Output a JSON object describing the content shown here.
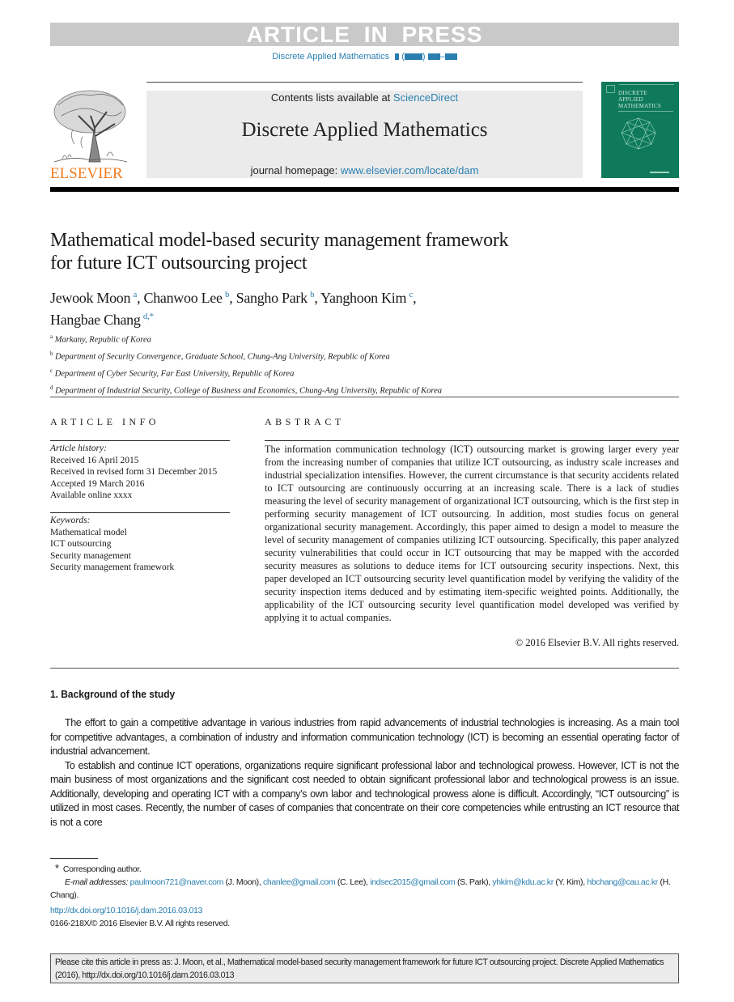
{
  "banner": {
    "text": "ARTICLE IN PRESS"
  },
  "running_head": {
    "journal": "Discrete Applied Mathematics"
  },
  "masthead": {
    "publisher": "ELSEVIER",
    "contents_prefix": "Contents lists available at ",
    "contents_link": "ScienceDirect",
    "journal_name": "Discrete Applied Mathematics",
    "homepage_prefix": "journal homepage: ",
    "homepage_link": "www.elsevier.com/locate/dam",
    "cover": {
      "line1": "DISCRETE",
      "line2": "APPLIED",
      "line3": "MATHEMATICS",
      "color": "#0e7a5b"
    }
  },
  "article": {
    "title_line1": "Mathematical model-based security management framework",
    "title_line2": "for future ICT outsourcing project",
    "authors": [
      {
        "name": "Jewook Moon",
        "aff": "a"
      },
      {
        "name": "Chanwoo Lee",
        "aff": "b"
      },
      {
        "name": "Sangho Park",
        "aff": "b"
      },
      {
        "name": "Yanghoon Kim",
        "aff": "c"
      },
      {
        "name": "Hangbae Chang",
        "aff": "d,*"
      }
    ],
    "affiliations": [
      {
        "label": "a",
        "text": "Markany, Republic of Korea"
      },
      {
        "label": "b",
        "text": "Department of Security Convergence, Graduate School, Chung-Ang University, Republic of Korea"
      },
      {
        "label": "c",
        "text": "Department of Cyber Security, Far East University, Republic of Korea"
      },
      {
        "label": "d",
        "text": "Department of Industrial Security, College of Business and Economics, Chung-Ang University, Republic of Korea"
      }
    ]
  },
  "article_info": {
    "heading": "ARTICLE INFO",
    "history_label": "Article history:",
    "history": [
      "Received 16 April 2015",
      "Received in revised form 31 December 2015",
      "Accepted 19 March 2016",
      "Available online xxxx"
    ],
    "keywords_label": "Keywords:",
    "keywords": [
      "Mathematical model",
      "ICT outsourcing",
      "Security management",
      "Security management framework"
    ]
  },
  "abstract": {
    "heading": "ABSTRACT",
    "text": "The information communication technology (ICT) outsourcing market is growing larger every year from the increasing number of companies that utilize ICT outsourcing, as in­dustry scale increases and industrial specialization intensifies. However, the current cir­cumstance is that security accidents related to ICT outsourcing are continuously occurring at an increasing scale. There is a lack of studies measuring the level of security management of organizational ICT outsourcing, which is the first step in performing security manage­ment of ICT outsourcing. In addition, most studies focus on general organizational secu­rity management. Accordingly, this paper aimed to design a model to measure the level of security management of companies utilizing ICT outsourcing. Specifically, this paper ana­lyzed security vulnerabilities that could occur in ICT outsourcing that may be mapped with the accorded security measures as solutions to deduce items for ICT outsourcing security inspections. Next, this paper developed an ICT outsourcing security level quantification model by verifying the validity of the security inspection items deduced and by estimating item-specific weighted points. Additionally, the applicability of the ICT outsourcing secu­rity level quantification model developed was verified by applying it to actual companies.",
    "copyright": "© 2016 Elsevier B.V. All rights reserved."
  },
  "section1": {
    "heading": "1.  Background of the study",
    "paragraphs": [
      "The effort to gain a competitive advantage in various industries from rapid advancements of industrial technologies is increasing. As a main tool for competitive advantages, a combination of industry and information communication technology (ICT) is becoming an essential operating factor of industrial advancement.",
      "To establish and continue ICT operations, organizations require significant professional labor and technological prowess. However, ICT is not the main business of most organizations and the significant cost needed to obtain significant professional labor and technological prowess is an issue. Additionally, developing and operating ICT with a company’s own labor and technological prowess alone is difficult. Accordingly, “ICT outsourcing” is utilized in most cases. Recently, the number of cases of companies that concentrate on their core competencies while entrusting an ICT resource that is not a core"
    ]
  },
  "footnotes": {
    "star": "*",
    "corresponding": "Corresponding author.",
    "email_label": "E-mail addresses:",
    "emails": [
      {
        "addr": "paulmoon721@naver.com",
        "who": "(J. Moon)"
      },
      {
        "addr": "chanlee@gmail.com",
        "who": "(C. Lee)"
      },
      {
        "addr": "indsec2015@gmail.com",
        "who": "(S. Park)"
      },
      {
        "addr": "yhkim@kdu.ac.kr",
        "who": "(Y. Kim)"
      },
      {
        "addr": "hbchang@cau.ac.kr",
        "who": "(H. Chang)."
      }
    ],
    "doi": "http://dx.doi.org/10.1016/j.dam.2016.03.013",
    "issn": "0166-218X/© 2016 Elsevier B.V. All rights reserved."
  },
  "cite_box": {
    "text": "Please cite this article in press as: J. Moon, et al., Mathematical model-based security management framework for future ICT outsourcing project. Discrete Applied Mathematics (2016), http://dx.doi.org/10.1016/j.dam.2016.03.013"
  }
}
